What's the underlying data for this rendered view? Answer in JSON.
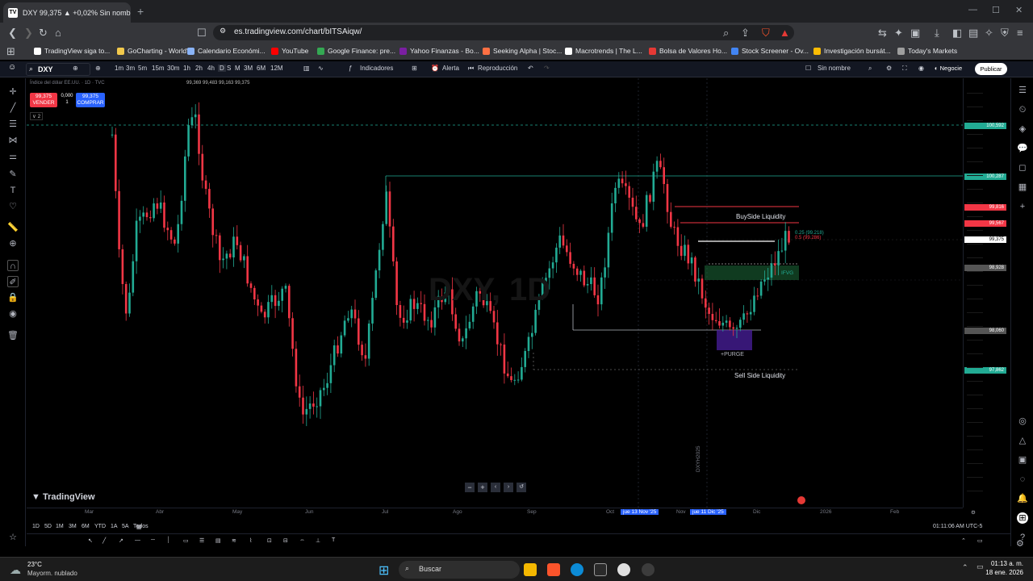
{
  "browser": {
    "tab_title": "DXY 99,375 ▲ +0,02% Sin nombre",
    "tab_favicon": "TV",
    "url": "es.tradingview.com/chart/bITSAiqw/",
    "bookmarks": [
      {
        "label": "TradingView siga to...",
        "color": "#ffffff"
      },
      {
        "label": "GoCharting - World'...",
        "color": "#f2c94c"
      },
      {
        "label": "Calendario Económi...",
        "color": "#8ab4f8"
      },
      {
        "label": "YouTube",
        "color": "#ff0000"
      },
      {
        "label": "Google Finance: pre...",
        "color": "#34a853"
      },
      {
        "label": "Yahoo Finanzas - Bo...",
        "color": "#7b1fa2"
      },
      {
        "label": "Seeking Alpha | Stoc...",
        "color": "#ff7043"
      },
      {
        "label": "Macrotrends | The L...",
        "color": "#ffffff"
      },
      {
        "label": "Bolsa de Valores Ho...",
        "color": "#e53935"
      },
      {
        "label": "Stock Screener - Ov...",
        "color": "#4285f4"
      },
      {
        "label": "Investigación bursát...",
        "color": "#fbbc04"
      },
      {
        "label": "Today's Markets",
        "color": "#9e9e9e"
      }
    ]
  },
  "toolbar": {
    "symbol": "DXY",
    "timeframes": [
      "1m",
      "3m",
      "5m",
      "15m",
      "30m",
      "1h",
      "2h",
      "4h",
      "D",
      "S",
      "M",
      "3M",
      "6M",
      "12M"
    ],
    "indicators_label": "Indicadores",
    "alert_label": "Alerta",
    "replay_label": "Reproducción",
    "layout_name": "Sin nombre",
    "trade_label": "Negocie",
    "publish_label": "Publicar"
  },
  "legend": {
    "title": "Índice del dólar EE.UU. · 1D · TVC",
    "ohlc": "99,369  99,483  99,163  99,375",
    "sell_price": "99,375",
    "sell_label": "VENDER",
    "spread": "0,000",
    "qty": "1",
    "buy_price": "99,375",
    "buy_label": "COMPRAR",
    "collapse": "2"
  },
  "watermark": "DXY, 1D",
  "annotations": {
    "buyside": "BuySide Liquidity",
    "sellside": "Sell Side Liquidity",
    "purge": "+PURGE",
    "ifvg": "IFVG",
    "fib1": "0.25 (99.218)",
    "fib2": "0.5 (99.286)",
    "vertical_label": "DXYH2025"
  },
  "price_axis": {
    "labels": [
      {
        "text": "100,592",
        "color": "#22ab94"
      },
      {
        "text": "100,287",
        "color": "#22ab94"
      },
      {
        "text": "99,816",
        "color": "#f23645"
      },
      {
        "text": "99,567",
        "color": "#f23645"
      },
      {
        "text": "99,375",
        "color": "#ffffff"
      },
      {
        "text": "98,928",
        "color": "#555555"
      },
      {
        "text": "98,060",
        "color": "#555555"
      },
      {
        "text": "97,862",
        "color": "#22ab94"
      }
    ]
  },
  "time_axis": {
    "labels": [
      "Mar",
      "Abr",
      "May",
      "Jun",
      "Jul",
      "Ago",
      "Sep",
      "Oct",
      "Nov",
      "Dic",
      "2026",
      "Feb",
      "Mar"
    ],
    "highlight1": "jue 13 Nov '25",
    "highlight2": "jue 11 Dic '25"
  },
  "bottom": {
    "ranges": [
      "1D",
      "5D",
      "1M",
      "3M",
      "6M",
      "YTD",
      "1A",
      "5A",
      "Todos"
    ],
    "clock": "01:11:06 AM UTC-5",
    "brand": "TradingView"
  },
  "taskbar": {
    "weather_temp": "23°C",
    "weather_desc": "Mayorm. nublado",
    "search": "Buscar",
    "time": "01:13 a. m.",
    "date": "18 ene. 2026"
  },
  "colors": {
    "up": "#22ab94",
    "down": "#f23645",
    "bg": "#000000"
  }
}
